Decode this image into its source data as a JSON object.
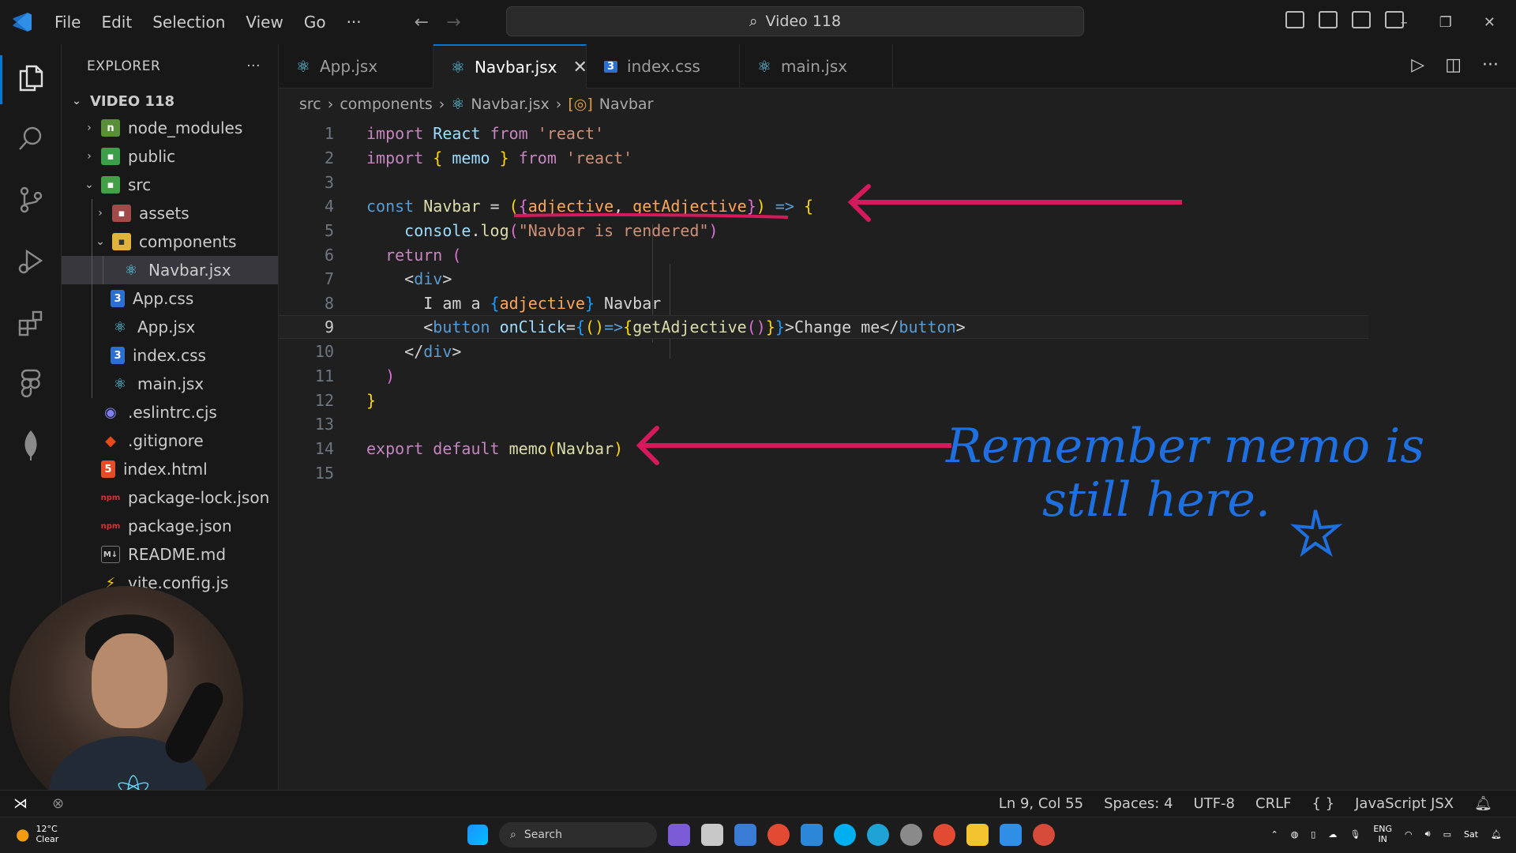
{
  "window": {
    "command_center": "Video 118",
    "menu": [
      "File",
      "Edit",
      "Selection",
      "View",
      "Go",
      "···"
    ]
  },
  "explorer": {
    "title": "EXPLORER",
    "more": "···",
    "folder": "VIDEO 118",
    "items": [
      {
        "label": "node_modules",
        "icon": "folder-node-icon"
      },
      {
        "label": "public",
        "icon": "folder-public-icon"
      },
      {
        "label": "src",
        "icon": "folder-src-icon"
      },
      {
        "label": "assets",
        "icon": "folder-assets-icon"
      },
      {
        "label": "components",
        "icon": "folder-components-icon"
      },
      {
        "label": "Navbar.jsx",
        "icon": "react-icon"
      },
      {
        "label": "App.css",
        "icon": "css-icon"
      },
      {
        "label": "App.jsx",
        "icon": "react-icon"
      },
      {
        "label": "index.css",
        "icon": "css-icon"
      },
      {
        "label": "main.jsx",
        "icon": "react-icon"
      },
      {
        "label": ".eslintrc.cjs",
        "icon": "eslint-icon"
      },
      {
        "label": ".gitignore",
        "icon": "git-icon"
      },
      {
        "label": "index.html",
        "icon": "html-icon"
      },
      {
        "label": "package-lock.json",
        "icon": "npm-icon"
      },
      {
        "label": "package.json",
        "icon": "npm-icon"
      },
      {
        "label": "README.md",
        "icon": "markdown-icon"
      },
      {
        "label": "vite.config.js",
        "icon": "vite-icon"
      }
    ]
  },
  "tabs": [
    {
      "label": "App.jsx",
      "active": false
    },
    {
      "label": "Navbar.jsx",
      "active": true
    },
    {
      "label": "index.css",
      "active": false
    },
    {
      "label": "main.jsx",
      "active": false
    }
  ],
  "breadcrumb": [
    "src",
    "components",
    "Navbar.jsx",
    "Navbar"
  ],
  "editor": {
    "current_line": 9,
    "line_numbers": [
      "1",
      "2",
      "3",
      "4",
      "5",
      "6",
      "7",
      "8",
      "9",
      "10",
      "11",
      "12",
      "13",
      "14",
      "15"
    ]
  },
  "annotation": {
    "line1": "Remember memo is",
    "line2": "still here."
  },
  "statusbar": {
    "position": "Ln 9, Col 55",
    "spaces": "Spaces: 4",
    "encoding": "UTF-8",
    "eol": "CRLF",
    "language": "JavaScript JSX"
  },
  "taskbar": {
    "temp": "12°C",
    "weather": "Clear",
    "search": "Search",
    "lang1": "ENG",
    "lang2": "IN",
    "day": "Sat"
  },
  "colors": {
    "accent": "#0078d4",
    "arrow": "#d6195c",
    "handwriting": "#1e6fe0"
  }
}
